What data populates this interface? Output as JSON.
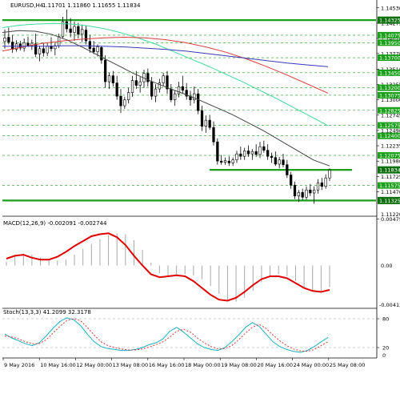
{
  "chart_data": [
    {
      "type": "candlestick",
      "title": "EURUSD,H4",
      "ohlc_header": "1.11701 1.11860 1.11655 1.11834",
      "ylim": [
        1.1109,
        1.1462
      ],
      "y_ticks": [
        1.1453,
        1.14275,
        1.1402,
        1.1377,
        1.1351,
        1.13255,
        1.13,
        1.12745,
        1.1249,
        1.12235,
        1.1198,
        1.11725,
        1.1147
      ],
      "y_tick_labels": [
        "1.14530",
        "1.14275",
        "1.14020",
        "1.13770",
        "1.13510",
        "1.13255",
        "1.13000",
        "1.12745",
        "1.12490",
        "1.12235",
        "1.11980",
        "1.11725",
        "1.11470"
      ],
      "bottom_tick_label": "1.11220",
      "highlighted_levels": [
        {
          "label": "1.14325",
          "value": 1.14325,
          "color": "#1aa01a"
        },
        {
          "label": "1.11834",
          "value": 1.11834,
          "color": "#1aa01a"
        },
        {
          "label": "1.11325",
          "value": 1.11325,
          "color": "#1aa01a"
        }
      ],
      "green_level_labels": [
        "1.14075",
        "1.13950",
        "1.13700",
        "1.13450",
        "1.13200",
        "1.13075",
        "1.12825",
        "1.12575",
        "1.12400",
        "1.12075",
        "1.11575"
      ],
      "green_levels": [
        1.14075,
        1.1395,
        1.137,
        1.1345,
        1.132,
        1.13075,
        1.12825,
        1.12575,
        1.124,
        1.12075,
        1.11575
      ],
      "support_lines": [
        1.14325,
        1.11834,
        1.11325
      ],
      "candles": [
        {
          "o": 1.1397,
          "h": 1.1417,
          "l": 1.1385,
          "c": 1.1403
        },
        {
          "o": 1.1404,
          "h": 1.142,
          "l": 1.1392,
          "c": 1.1396
        },
        {
          "o": 1.1396,
          "h": 1.1408,
          "l": 1.1378,
          "c": 1.1384
        },
        {
          "o": 1.1384,
          "h": 1.1399,
          "l": 1.138,
          "c": 1.1393
        },
        {
          "o": 1.1393,
          "h": 1.1398,
          "l": 1.1382,
          "c": 1.1386
        },
        {
          "o": 1.1386,
          "h": 1.1402,
          "l": 1.138,
          "c": 1.1395
        },
        {
          "o": 1.1394,
          "h": 1.1405,
          "l": 1.1388,
          "c": 1.139
        },
        {
          "o": 1.139,
          "h": 1.14,
          "l": 1.1383,
          "c": 1.1394
        },
        {
          "o": 1.1393,
          "h": 1.141,
          "l": 1.1371,
          "c": 1.1376
        },
        {
          "o": 1.1376,
          "h": 1.139,
          "l": 1.1364,
          "c": 1.1385
        },
        {
          "o": 1.1385,
          "h": 1.1394,
          "l": 1.1372,
          "c": 1.1378
        },
        {
          "o": 1.1378,
          "h": 1.1394,
          "l": 1.1373,
          "c": 1.1389
        },
        {
          "o": 1.1389,
          "h": 1.1404,
          "l": 1.138,
          "c": 1.1385
        },
        {
          "o": 1.1385,
          "h": 1.1395,
          "l": 1.1374,
          "c": 1.139
        },
        {
          "o": 1.139,
          "h": 1.141,
          "l": 1.1386,
          "c": 1.1405
        },
        {
          "o": 1.1405,
          "h": 1.1438,
          "l": 1.1402,
          "c": 1.143
        },
        {
          "o": 1.143,
          "h": 1.145,
          "l": 1.1412,
          "c": 1.1418
        },
        {
          "o": 1.1418,
          "h": 1.1436,
          "l": 1.1404,
          "c": 1.1412
        },
        {
          "o": 1.1412,
          "h": 1.143,
          "l": 1.1398,
          "c": 1.1422
        },
        {
          "o": 1.1422,
          "h": 1.1428,
          "l": 1.1402,
          "c": 1.1409
        },
        {
          "o": 1.1409,
          "h": 1.1425,
          "l": 1.1396,
          "c": 1.1417
        },
        {
          "o": 1.1416,
          "h": 1.1423,
          "l": 1.1392,
          "c": 1.1398
        },
        {
          "o": 1.1397,
          "h": 1.1408,
          "l": 1.1378,
          "c": 1.1385
        },
        {
          "o": 1.1386,
          "h": 1.1398,
          "l": 1.1376,
          "c": 1.138
        },
        {
          "o": 1.138,
          "h": 1.1392,
          "l": 1.1372,
          "c": 1.1388
        },
        {
          "o": 1.1387,
          "h": 1.139,
          "l": 1.136,
          "c": 1.1366
        },
        {
          "o": 1.1366,
          "h": 1.1374,
          "l": 1.132,
          "c": 1.133
        },
        {
          "o": 1.133,
          "h": 1.1345,
          "l": 1.1318,
          "c": 1.134
        },
        {
          "o": 1.134,
          "h": 1.1348,
          "l": 1.1322,
          "c": 1.1328
        },
        {
          "o": 1.1328,
          "h": 1.134,
          "l": 1.13,
          "c": 1.1306
        },
        {
          "o": 1.1306,
          "h": 1.1318,
          "l": 1.1278,
          "c": 1.129
        },
        {
          "o": 1.129,
          "h": 1.1305,
          "l": 1.1285,
          "c": 1.13
        },
        {
          "o": 1.13,
          "h": 1.132,
          "l": 1.1294,
          "c": 1.1312
        },
        {
          "o": 1.1312,
          "h": 1.134,
          "l": 1.1305,
          "c": 1.1332
        },
        {
          "o": 1.1332,
          "h": 1.1348,
          "l": 1.1318,
          "c": 1.1324
        },
        {
          "o": 1.1324,
          "h": 1.1338,
          "l": 1.1312,
          "c": 1.133
        },
        {
          "o": 1.133,
          "h": 1.135,
          "l": 1.132,
          "c": 1.1344
        },
        {
          "o": 1.1344,
          "h": 1.1352,
          "l": 1.1322,
          "c": 1.133
        },
        {
          "o": 1.133,
          "h": 1.1338,
          "l": 1.13,
          "c": 1.1306
        },
        {
          "o": 1.1306,
          "h": 1.1326,
          "l": 1.1296,
          "c": 1.1318
        },
        {
          "o": 1.1318,
          "h": 1.1335,
          "l": 1.1312,
          "c": 1.1328
        },
        {
          "o": 1.1328,
          "h": 1.1345,
          "l": 1.1322,
          "c": 1.134
        },
        {
          "o": 1.134,
          "h": 1.1348,
          "l": 1.131,
          "c": 1.1318
        },
        {
          "o": 1.1318,
          "h": 1.1326,
          "l": 1.1296,
          "c": 1.13
        },
        {
          "o": 1.13,
          "h": 1.1316,
          "l": 1.129,
          "c": 1.131
        },
        {
          "o": 1.131,
          "h": 1.133,
          "l": 1.1304,
          "c": 1.1322
        },
        {
          "o": 1.1322,
          "h": 1.134,
          "l": 1.131,
          "c": 1.1316
        },
        {
          "o": 1.1316,
          "h": 1.1328,
          "l": 1.13,
          "c": 1.1306
        },
        {
          "o": 1.1306,
          "h": 1.1315,
          "l": 1.129,
          "c": 1.13
        },
        {
          "o": 1.13,
          "h": 1.1322,
          "l": 1.1294,
          "c": 1.131
        },
        {
          "o": 1.131,
          "h": 1.1318,
          "l": 1.1276,
          "c": 1.1282
        },
        {
          "o": 1.1282,
          "h": 1.129,
          "l": 1.1248,
          "c": 1.1256
        },
        {
          "o": 1.1256,
          "h": 1.1274,
          "l": 1.1245,
          "c": 1.1266
        },
        {
          "o": 1.1266,
          "h": 1.1275,
          "l": 1.125,
          "c": 1.1254
        },
        {
          "o": 1.1254,
          "h": 1.1264,
          "l": 1.1224,
          "c": 1.123
        },
        {
          "o": 1.123,
          "h": 1.1236,
          "l": 1.1192,
          "c": 1.1198
        },
        {
          "o": 1.1198,
          "h": 1.1208,
          "l": 1.1192,
          "c": 1.1196
        },
        {
          "o": 1.1196,
          "h": 1.1204,
          "l": 1.1192,
          "c": 1.1199
        },
        {
          "o": 1.1198,
          "h": 1.1206,
          "l": 1.119,
          "c": 1.1195
        },
        {
          "o": 1.1195,
          "h": 1.1204,
          "l": 1.119,
          "c": 1.12
        },
        {
          "o": 1.12,
          "h": 1.1215,
          "l": 1.1195,
          "c": 1.121
        },
        {
          "o": 1.121,
          "h": 1.1222,
          "l": 1.12,
          "c": 1.1206
        },
        {
          "o": 1.1206,
          "h": 1.122,
          "l": 1.12,
          "c": 1.1215
        },
        {
          "o": 1.1215,
          "h": 1.1224,
          "l": 1.1205,
          "c": 1.121
        },
        {
          "o": 1.121,
          "h": 1.1218,
          "l": 1.12,
          "c": 1.1214
        },
        {
          "o": 1.1214,
          "h": 1.1226,
          "l": 1.1205,
          "c": 1.1209
        },
        {
          "o": 1.1209,
          "h": 1.123,
          "l": 1.1203,
          "c": 1.1222
        },
        {
          "o": 1.1222,
          "h": 1.1232,
          "l": 1.1212,
          "c": 1.1216
        },
        {
          "o": 1.1216,
          "h": 1.1226,
          "l": 1.12,
          "c": 1.1206
        },
        {
          "o": 1.1206,
          "h": 1.1212,
          "l": 1.1195,
          "c": 1.1204
        },
        {
          "o": 1.1204,
          "h": 1.1214,
          "l": 1.119,
          "c": 1.1193
        },
        {
          "o": 1.1193,
          "h": 1.1205,
          "l": 1.1186,
          "c": 1.12
        },
        {
          "o": 1.12,
          "h": 1.121,
          "l": 1.1188,
          "c": 1.1192
        },
        {
          "o": 1.1192,
          "h": 1.12,
          "l": 1.117,
          "c": 1.1175
        },
        {
          "o": 1.1175,
          "h": 1.118,
          "l": 1.1152,
          "c": 1.1158
        },
        {
          "o": 1.1158,
          "h": 1.1164,
          "l": 1.1135,
          "c": 1.114
        },
        {
          "o": 1.114,
          "h": 1.115,
          "l": 1.113,
          "c": 1.1146
        },
        {
          "o": 1.1146,
          "h": 1.1152,
          "l": 1.1133,
          "c": 1.1138
        },
        {
          "o": 1.1138,
          "h": 1.1156,
          "l": 1.1134,
          "c": 1.115
        },
        {
          "o": 1.115,
          "h": 1.116,
          "l": 1.114,
          "c": 1.1145
        },
        {
          "o": 1.1145,
          "h": 1.1156,
          "l": 1.1127,
          "c": 1.115
        },
        {
          "o": 1.115,
          "h": 1.1168,
          "l": 1.1144,
          "c": 1.1162
        },
        {
          "o": 1.1162,
          "h": 1.117,
          "l": 1.115,
          "c": 1.1156
        },
        {
          "o": 1.1156,
          "h": 1.1176,
          "l": 1.1152,
          "c": 1.117
        },
        {
          "o": 1.117,
          "h": 1.1186,
          "l": 1.1165,
          "c": 1.1183
        }
      ],
      "moving_averages": [
        {
          "color": "#3fd99a",
          "values": [
            1.142,
            1.1424,
            1.1426,
            1.1427,
            1.1426,
            1.1423,
            1.1418,
            1.1411,
            1.1402,
            1.1392,
            1.138,
            1.1368,
            1.1356,
            1.1343,
            1.133,
            1.1316,
            1.1302,
            1.1287,
            1.1272,
            1.1257
          ]
        },
        {
          "color": "#d93a3a",
          "values": [
            1.1381,
            1.1388,
            1.1394,
            1.1398,
            1.1401,
            1.1403,
            1.1404,
            1.1403,
            1.14,
            1.1395,
            1.1388,
            1.1379,
            1.1368,
            1.1355,
            1.1341,
            1.1326,
            1.1311
          ]
        },
        {
          "color": "#3838b8",
          "values": [
            1.1389,
            1.1389,
            1.1389,
            1.139,
            1.139,
            1.1389,
            1.1388,
            1.1386,
            1.1384,
            1.1381,
            1.1377,
            1.1373,
            1.1369,
            1.1365,
            1.1361,
            1.1358,
            1.1355
          ]
        },
        {
          "color": "#444444",
          "values": [
            1.1412,
            1.1415,
            1.1414,
            1.1409,
            1.1399,
            1.1386,
            1.1372,
            1.1358,
            1.1344,
            1.1332,
            1.1321,
            1.1311,
            1.13,
            1.1288,
            1.1276,
            1.1262,
            1.1248,
            1.1232,
            1.1216,
            1.12,
            1.119
          ]
        }
      ]
    },
    {
      "type": "line",
      "title": "MACD(12,26,9) -0.002091 -0.002744",
      "ylim": [
        -0.0043,
        0.0048
      ],
      "y_tick_labels": [
        "0.00475",
        "0.00"
      ],
      "bottom_tick_label": "-0.004127",
      "histogram": [
        0.0004,
        0.0009,
        0.0012,
        0.0011,
        0.0008,
        0.0006,
        0.0005,
        0.0006,
        0.0011,
        0.0017,
        0.0022,
        0.0027,
        0.0031,
        0.0033,
        0.0032,
        0.0026,
        0.0016,
        0.0003,
        -0.0008,
        -0.0012,
        -0.0011,
        -0.0009,
        -0.001,
        -0.0014,
        -0.0021,
        -0.0029,
        -0.0035,
        -0.0037,
        -0.0033,
        -0.0026,
        -0.0017,
        -0.0011,
        -0.0009,
        -0.0011,
        -0.0016,
        -0.0022,
        -0.0026,
        -0.0026,
        -0.0022
      ],
      "signal": [
        0.0007,
        0.001,
        0.0011,
        0.0008,
        0.0006,
        0.0006,
        0.0009,
        0.0014,
        0.002,
        0.0025,
        0.003,
        0.0032,
        0.0033,
        0.0029,
        0.0021,
        0.001,
        0.0,
        -0.0009,
        -0.0012,
        -0.0011,
        -0.001,
        -0.0011,
        -0.0016,
        -0.0023,
        -0.003,
        -0.0035,
        -0.0036,
        -0.0033,
        -0.0027,
        -0.002,
        -0.0014,
        -0.0011,
        -0.0011,
        -0.0013,
        -0.0018,
        -0.0023,
        -0.0026,
        -0.0027,
        -0.0025
      ]
    },
    {
      "type": "line",
      "title": "Stoch(13,3,3) 41.2099 32.3178",
      "ylim": [
        0,
        100
      ],
      "y_ticks": [
        80,
        20
      ],
      "y_tick_labels": [
        "80",
        "20"
      ],
      "bottom_tick_label": "0",
      "levels": [
        80,
        20
      ],
      "series": [
        {
          "color": "#1ab0c0",
          "values": [
            48,
            40,
            34,
            28,
            24,
            30,
            44,
            60,
            74,
            82,
            78,
            66,
            48,
            32,
            22,
            18,
            16,
            14,
            14,
            16,
            20,
            26,
            30,
            38,
            54,
            62,
            52,
            40,
            28,
            20,
            16,
            14,
            20,
            32,
            46,
            62,
            72,
            64,
            48,
            32,
            22,
            16,
            12,
            10,
            14,
            22,
            32,
            41
          ]
        },
        {
          "color": "#d93a3a",
          "values": [
            44,
            42,
            38,
            32,
            28,
            28,
            36,
            50,
            64,
            76,
            80,
            76,
            62,
            46,
            32,
            24,
            20,
            17,
            15,
            15,
            17,
            21,
            26,
            32,
            42,
            54,
            58,
            52,
            40,
            30,
            22,
            17,
            18,
            24,
            36,
            50,
            62,
            68,
            60,
            46,
            34,
            24,
            17,
            13,
            12,
            16,
            24,
            32
          ]
        }
      ]
    }
  ],
  "x_tick_labels": [
    "9 May 2016",
    "10 May 16:00",
    "12 May 00:00",
    "13 May 08:00",
    "16 May 16:00",
    "18 May 00:00",
    "19 May 08:00",
    "20 May 16:00",
    "24 May 00:00",
    "25 May 08:00"
  ],
  "colors": {
    "background": "#ffffff",
    "grid": "#cfcfcf",
    "bull": "#ffffff",
    "bear": "#000000",
    "level": "#1aa01a",
    "axis_tag": "#1aa01a",
    "macd_signal": "#e00000",
    "macd_hist": "#a8a8a8",
    "stoch_level": "#999999"
  }
}
